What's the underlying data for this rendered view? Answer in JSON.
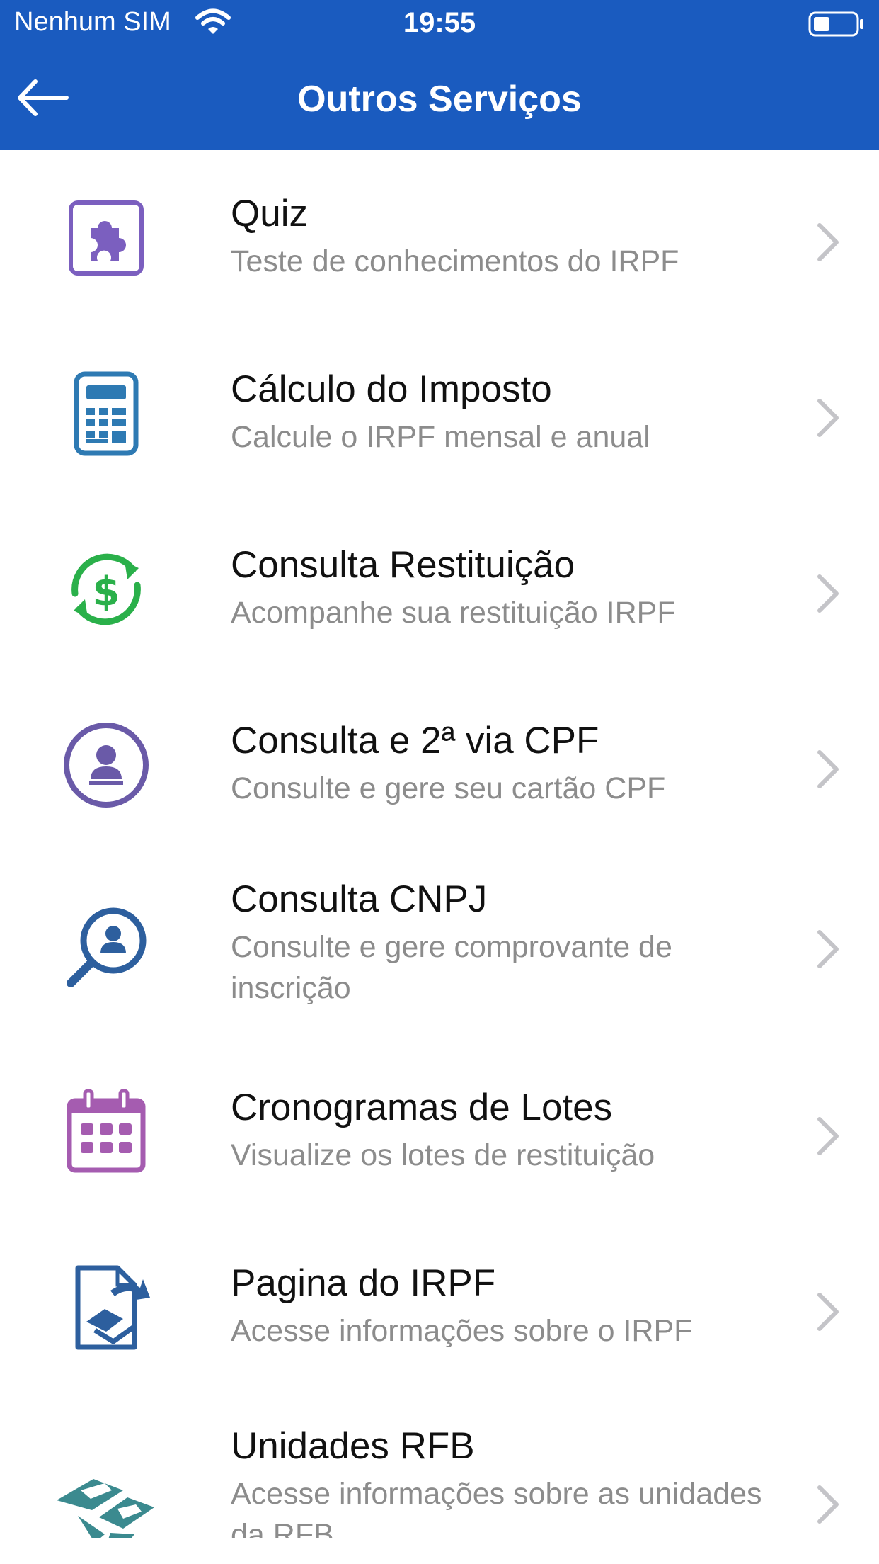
{
  "status_bar": {
    "carrier": "Nenhum SIM",
    "time": "19:55"
  },
  "nav": {
    "title": "Outros Serviços"
  },
  "services": [
    {
      "title": "Quiz",
      "subtitle": "Teste de conhecimentos do IRPF",
      "icon": "puzzle-icon",
      "color": "#7b5fbf"
    },
    {
      "title": "Cálculo do Imposto",
      "subtitle": "Calcule o IRPF mensal e anual",
      "icon": "calculator-icon",
      "color": "#2e7ab3"
    },
    {
      "title": "Consulta Restituição",
      "subtitle": "Acompanhe sua restituição IRPF",
      "icon": "dollar-refresh-icon",
      "color": "#2ab04a"
    },
    {
      "title": "Consulta e 2ª via CPF",
      "subtitle": "Consulte e gere seu cartão CPF",
      "icon": "user-circle-icon",
      "color": "#6a5aa8"
    },
    {
      "title": "Consulta CNPJ",
      "subtitle": "Consulte e gere comprovante de inscrição",
      "icon": "search-user-icon",
      "color": "#2d5f9e"
    },
    {
      "title": "Cronogramas de Lotes",
      "subtitle": "Visualize os lotes de restituição",
      "icon": "calendar-icon",
      "color": "#a55cb0"
    },
    {
      "title": "Pagina do IRPF",
      "subtitle": "Acesse informações sobre o IRPF",
      "icon": "document-share-icon",
      "color": "#2d5f9e"
    },
    {
      "title": "Unidades RFB",
      "subtitle": "Acesse informações sobre as unidades da RFB",
      "icon": "rfb-logo-icon",
      "color": "#3b8a8f"
    }
  ]
}
